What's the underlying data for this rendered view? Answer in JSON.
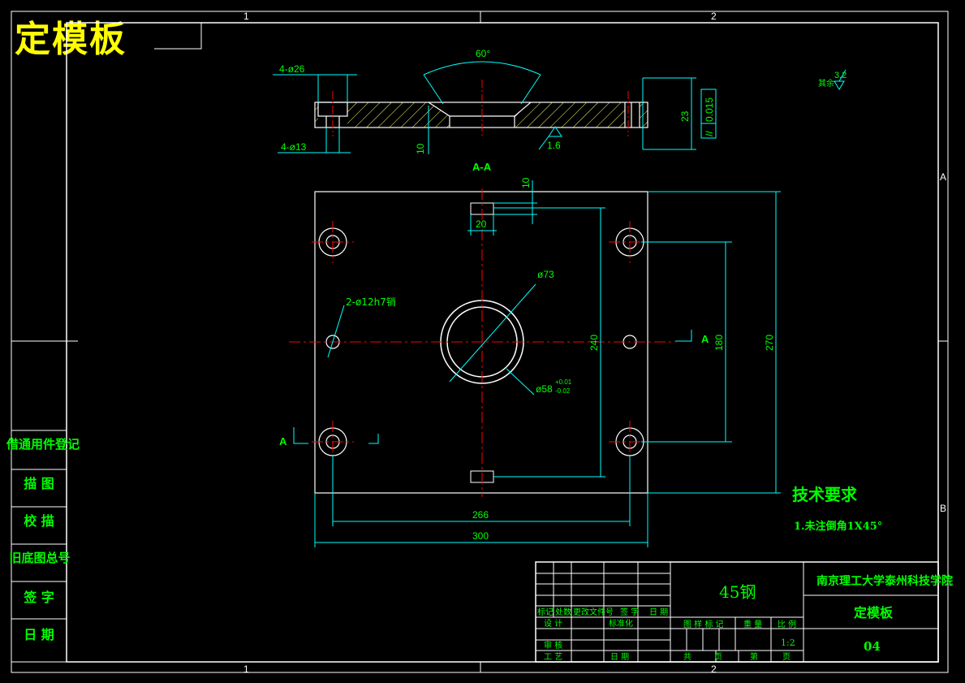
{
  "title": "定模板",
  "zones": {
    "top_1": "1",
    "top_2": "2",
    "bottom_1": "1",
    "bottom_2": "2",
    "right_a": "A",
    "right_b": "B"
  },
  "section": {
    "label": "A-A",
    "dims": {
      "angle": "60°",
      "cbore": "4-ø26",
      "thru": "4-ø13",
      "depth": "10",
      "thickness": "23",
      "roughness": "1.6",
      "tolerance_symbol": "//",
      "tolerance_value": "0.015"
    }
  },
  "plan": {
    "dims": {
      "slot_depth": "10",
      "slot_width": "20",
      "bore": "ø73",
      "center_bore": "ø58",
      "center_bore_tol_upper": "+0.01",
      "center_bore_tol_lower": "-0.02",
      "pin_holes": "2-ø12h7销",
      "height_inner": "240",
      "height_holes": "180",
      "height_total": "270",
      "width_holes": "266",
      "width_total": "300"
    },
    "section_marks": {
      "left": "A",
      "right": "A"
    }
  },
  "surface_note": {
    "label": "其余",
    "value": "3.2"
  },
  "tech_req": {
    "title": "技术要求",
    "item_1": "1.未注倒角1X45°"
  },
  "side_table": [
    "借通用件登记",
    "描 图",
    "校 描",
    "旧底图总号",
    "签 字",
    "日 期"
  ],
  "title_block": {
    "material": "45钢",
    "school": "南京理工大学泰州科技学院",
    "part_name": "定模板",
    "drawing_no": "04",
    "row_marks": [
      "标记",
      "处数",
      "更改文件号",
      "签 字",
      "日 期"
    ],
    "design": "设 计",
    "standard": "标准化",
    "review": "审 核",
    "process": "工 艺",
    "date": "日 期",
    "stage_mark": "图 样 标 记",
    "weight": "重 量",
    "ratio": "比 例",
    "scale": "1:2",
    "total": "共",
    "page": "页",
    "sheet": "第",
    "page2": "页"
  },
  "colors": {
    "line": "#ffffff",
    "dim": "#00ffff",
    "text": "#00ff00",
    "center": "#ff0000",
    "title": "#ffff00"
  }
}
